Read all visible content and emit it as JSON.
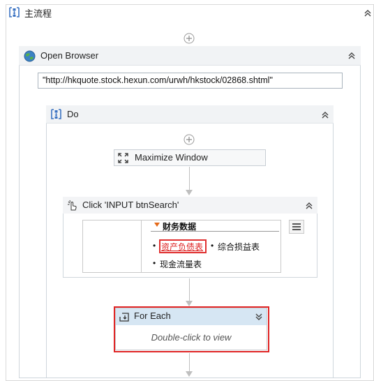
{
  "main_flow": {
    "title": "主流程"
  },
  "open_browser": {
    "title": "Open Browser",
    "url": "\"http://hkquote.stock.hexun.com/urwh/hkstock/02868.shtml\""
  },
  "do": {
    "title": "Do"
  },
  "maximize_window": {
    "title": "Maximize Window"
  },
  "click": {
    "title": "Click 'INPUT  btnSearch'",
    "preview": {
      "section_title": "财务数据",
      "links": [
        "资产负债表",
        "综合损益表",
        "现金流量表"
      ]
    }
  },
  "for_each": {
    "title": "For Each",
    "subtitle": "Double-click to view"
  },
  "icons": {
    "sequence": "sequence-icon",
    "globe": "globe-icon",
    "collapse": "double-chevron-up-icon",
    "expand": "double-chevron-down-icon",
    "add": "plus-circle-icon",
    "maximize": "maximize-icon",
    "click": "click-cursor-icon",
    "foreach": "for-each-icon",
    "menu": "hamburger-menu-icon"
  },
  "colors": {
    "highlight_red": "#e02424",
    "for_each_header": "#d6e6f3",
    "link_red": "#d22222",
    "section_arrow": "#e46a1a"
  }
}
